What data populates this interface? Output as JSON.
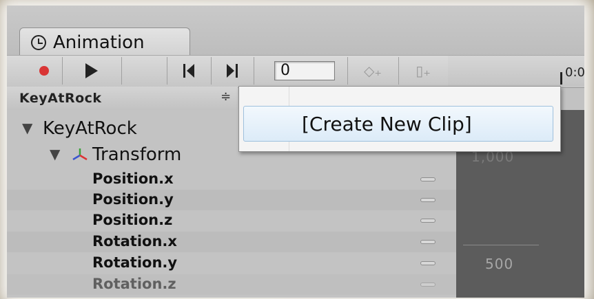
{
  "window": {
    "tab_title": "Animation"
  },
  "toolbar": {
    "frame_value": "0",
    "time_label": "0:0"
  },
  "clip_selector": {
    "selected": "KeyAtRock",
    "arrows": "≑"
  },
  "dropdown": {
    "items": [
      "[Create New Clip]"
    ]
  },
  "hierarchy": {
    "root": "KeyAtRock",
    "component": "Transform",
    "properties": [
      "Position.x",
      "Position.y",
      "Position.z",
      "Rotation.x",
      "Rotation.y",
      "Rotation.z"
    ]
  },
  "curve": {
    "labels": [
      "1,000",
      "500"
    ]
  },
  "icons": [
    "clock-icon",
    "record-icon",
    "play-icon",
    "prev-key-icon",
    "next-key-icon",
    "add-keyframe-icon",
    "add-event-icon",
    "foldout-arrow-icon",
    "transform-axis-icon",
    "property-handle-icon"
  ],
  "colors": {
    "record": "#d93535",
    "dropdown_highlight": "#dcebf8",
    "curve_bg": "#5c5c5c"
  }
}
